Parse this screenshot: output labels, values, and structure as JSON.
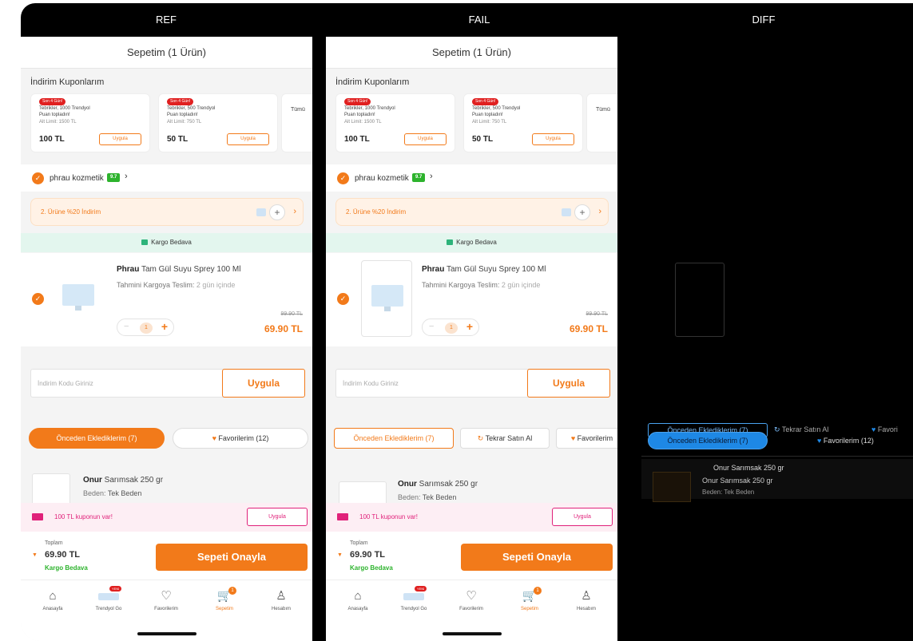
{
  "panels": {
    "ref": "REF",
    "fail": "FAIL",
    "diff": "DIFF"
  },
  "cart": {
    "title": "Sepetim (1 Ürün)",
    "coupons_title": "İndirim Kuponlarım",
    "coupons": [
      {
        "badge": "Son 4 Gün!",
        "line1": "Tebrikler, 1000 Trendyol",
        "line2": "Puan topladın!",
        "limit": "Alt Limit: 1500 TL",
        "amount": "100 TL",
        "apply": "Uygula"
      },
      {
        "badge": "Son 4 Gün!",
        "line1": "Tebrikler, 500 Trendyol",
        "line2": "Puan topladın!",
        "limit": "Alt Limit: 750 TL",
        "amount": "50 TL",
        "apply": "Uygula"
      }
    ],
    "coupons_all": "Tümü",
    "seller": {
      "name": "phrau kozmetik",
      "rating": "9.7"
    },
    "promo": "2. Ürüne %20 İndirim",
    "shipping_banner": "Kargo Bedava",
    "product": {
      "brand": "Phrau",
      "name": "Tam Gül Suyu Sprey 100 Ml",
      "delivery_label": "Tahmini Kargoya Teslim:",
      "delivery_value": "2 gün içinde",
      "qty": "1",
      "old_price": "99.90 TL",
      "price": "69.90 TL"
    },
    "discount_code": {
      "placeholder": "İndirim Kodu Giriniz",
      "button": "Uygula"
    },
    "tabs_ref": {
      "previous": "Önceden Eklediklerim (7)",
      "favorites": "Favorilerim (12)"
    },
    "tabs_fail": {
      "previous": "Önceden Eklediklerim (7)",
      "rebuy": "Tekrar Satın Al",
      "favorites": "Favorilerim"
    },
    "reco": {
      "brand": "Onur",
      "name": "Sarımsak 250 gr",
      "size_label": "Beden:",
      "size_value": "Tek Beden"
    },
    "coupon_bar": {
      "text": "100 TL kuponun var!",
      "button": "Uygula"
    },
    "summary": {
      "label": "Toplam",
      "total": "69.90 TL",
      "shipping": "Kargo Bedava",
      "confirm": "Sepeti Onayla"
    },
    "tabbar": [
      {
        "label": "Anasayfa",
        "icon": "home-icon"
      },
      {
        "label": "Trendyol Go",
        "icon": "go-icon",
        "badge": "YENİ"
      },
      {
        "label": "Favorilerim",
        "icon": "heart-icon"
      },
      {
        "label": "Sepetim",
        "icon": "cart-icon",
        "badge": "1"
      },
      {
        "label": "Hesabım",
        "icon": "user-icon"
      }
    ]
  },
  "diff": {
    "pill_top": "Önceden Eklediklerim (7)",
    "pill_bottom": "Önceden Eklediklerim (7)",
    "rebuy": "Tekrar Satın Al",
    "fav_short": "Favori",
    "fav": "Favorilerim (12)",
    "name1": "Onur Sarımsak 250 gr",
    "name2": "Onur Sarımsak 250 gr",
    "size": "Beden: Tek Beden"
  },
  "colors": {
    "accent": "#f27a1a",
    "green": "#2db32d",
    "pink": "#e0217a",
    "diff_blue": "#1e88e5"
  }
}
